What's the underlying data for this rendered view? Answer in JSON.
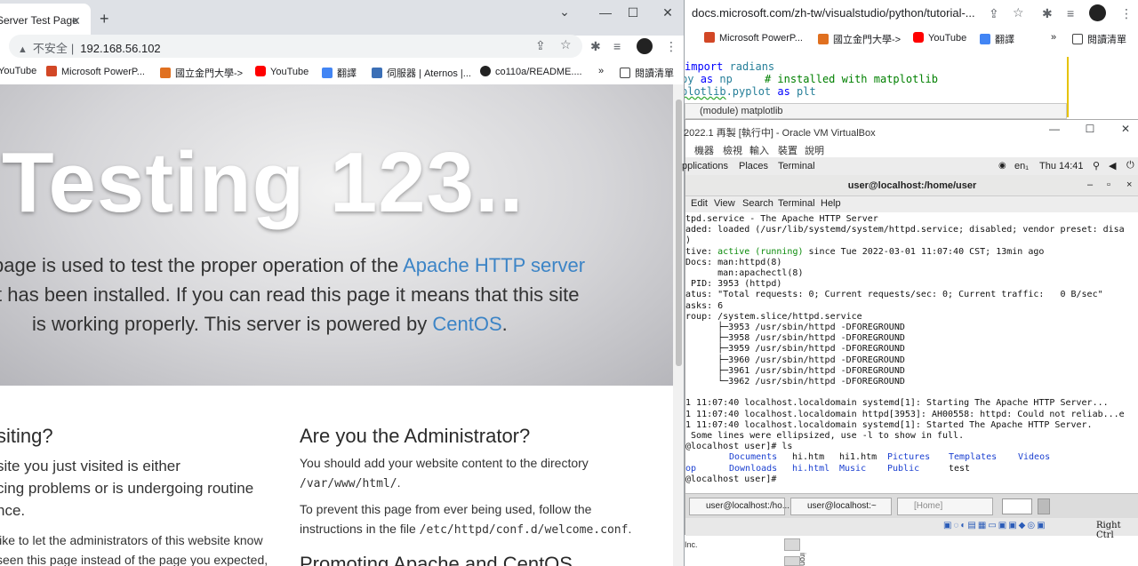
{
  "left_browser": {
    "tab_title": "Server Test Page",
    "new_tab": "+",
    "window_controls": {
      "minimize": "⌄",
      "min": "—",
      "max": "☐",
      "close": "✕"
    },
    "address": {
      "insecure_label": "不安全",
      "separator": "|",
      "url": "192.168.56.102"
    },
    "bookmarks": [
      "YouTube",
      "Microsoft PowerP...",
      "國立金門大學->",
      "YouTube",
      "翻譯",
      "伺服器 | Aternos |...",
      "co110a/README...."
    ],
    "bookmarks_more": "»",
    "reading_list": "閱讀清單",
    "hero": {
      "title": "Testing 123..",
      "line1_pre": "page is used to test the proper operation of the ",
      "line1_link": "Apache HTTP server",
      "line2": "t has been installed. If you can read this page it means that this site",
      "line3_pre": "is working properly. This server is powered by ",
      "line3_link": "CentOS",
      "line3_post": "."
    },
    "left_col": {
      "heading": "siting?",
      "l1": "site you just visited is either",
      "l2": "cing problems or is undergoing routine",
      "l3": "nce.",
      "l4": " like to let the administrators of this website know",
      "l5": "seen this page instead of the page you expected,"
    },
    "right_col": {
      "heading": "Are you the Administrator?",
      "p1a": "You should add your website content to the directory",
      "p1b_code": "/var/www/html/",
      "p1b_post": ".",
      "p2a": "To prevent this page from ever being used, follow the",
      "p2b_pre": "instructions in the file ",
      "p2b_code": "/etc/httpd/conf.d/welcome.conf",
      "p2b_post": ".",
      "heading2": "Promoting Apache and CentOS"
    }
  },
  "right_browser": {
    "url": "docs.microsoft.com/zh-tw/visualstudio/python/tutorial-...",
    "bookmarks": [
      "Microsoft PowerP...",
      "國立金門大學->",
      "YouTube",
      "翻譯"
    ],
    "bookmarks_more": "»",
    "reading_list": "閱讀清單",
    "code": {
      "l1_kw": "import",
      "l1_rest": " radians",
      "l2_pre": "py ",
      "l2_kw": "as",
      "l2_mid": " np     ",
      "l2_cmt": "# installed with matplotlib",
      "l3_a": "plotlib",
      "l3_b": ".pyplot ",
      "l3_kw": "as",
      "l3_c": " plt",
      "hint": "(module) matplotlib"
    },
    "below_inc": "Inc.",
    "below_side": "ironmer"
  },
  "vbox": {
    "title": "2022.1 再製 [執行中] - Oracle VM VirtualBox",
    "menu": [
      "機器",
      "檢視",
      "輸入",
      "裝置",
      "說明"
    ],
    "gnome": {
      "apps": "pplications",
      "places": "Places",
      "terminal": "Terminal",
      "lang": "en₁",
      "time": "Thu 14:41"
    },
    "term_title": "user@localhost:/home/user",
    "term_menu": [
      "Edit",
      "View",
      "Search",
      "Terminal",
      "Help"
    ],
    "lines": [
      "ttpd.service - The Apache HTTP Server",
      "oaded: loaded (/usr/lib/systemd/system/httpd.service; disabled; vendor preset: disa",
      "d)",
      "ctive: |active (running)| since Tue 2022-03-01 11:07:40 CST; 13min ago",
      " Docs: man:httpd(8)",
      "       man:apachectl(8)",
      "n PID: 3953 (httpd)",
      "tatus: \"Total requests: 0; Current requests/sec: 0; Current traffic:   0 B/sec\"",
      "Tasks: 6",
      "Group: /system.slice/httpd.service",
      "       ├─3953 /usr/sbin/httpd -DFOREGROUND",
      "       ├─3958 /usr/sbin/httpd -DFOREGROUND",
      "       ├─3959 /usr/sbin/httpd -DFOREGROUND",
      "       ├─3960 /usr/sbin/httpd -DFOREGROUND",
      "       ├─3961 /usr/sbin/httpd -DFOREGROUND",
      "       └─3962 /usr/sbin/httpd -DFOREGROUND",
      "",
      "01 11:07:40 localhost.localdomain systemd[1]: Starting The Apache HTTP Server...",
      "01 11:07:40 localhost.localdomain httpd[3953]: AH00558: httpd: Could not reliab...e",
      "01 11:07:40 localhost.localdomain systemd[1]: Started The Apache HTTP Server.",
      ": Some lines were ellipsized, use -l to show in full.",
      "t@localhost user]# ls"
    ],
    "ls_row1": [
      "  ",
      "Documents",
      "hi.htm  ",
      "hi1.htm  ",
      "Pictures",
      "Templates",
      "Videos"
    ],
    "ls_row2": [
      "top",
      "Downloads",
      "hi.html ",
      "Music    ",
      "Public  ",
      "test"
    ],
    "prompt": "t@localhost user]# ",
    "taskbar": [
      "user@localhost:/ho...",
      "user@localhost:~",
      "[Home]"
    ],
    "status_right": "Right Ctrl"
  }
}
